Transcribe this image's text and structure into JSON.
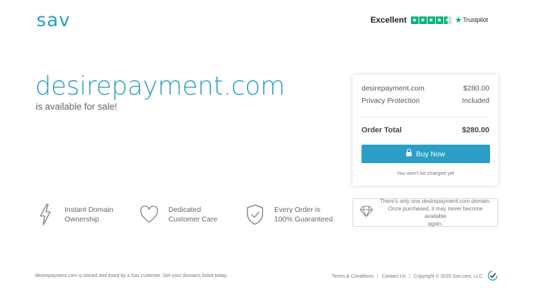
{
  "header": {
    "logo": "sav",
    "trustpilot": {
      "rating_label": "Excellent",
      "brand": "Trustpilot",
      "stars": 4.5
    }
  },
  "hero": {
    "domain": "desirepayment.com",
    "subtitle": "is available for sale!"
  },
  "order": {
    "items": [
      {
        "label": "desirepayment.com",
        "value": "$280.00"
      },
      {
        "label": "Privacy Protection",
        "value": "Included"
      }
    ],
    "total_label": "Order Total",
    "total_value": "$280.00",
    "buy_label": "Buy Now",
    "note": "You won't be charged yet"
  },
  "features": [
    {
      "line1": "Instant Domain",
      "line2": "Ownership",
      "icon": "lightning-icon"
    },
    {
      "line1": "Dedicated",
      "line2": "Customer Care",
      "icon": "heart-icon"
    },
    {
      "line1": "Every Order is",
      "line2": "100% Guaranteed",
      "icon": "shield-check-icon"
    }
  ],
  "notice": {
    "icon": "diamond-icon",
    "line1": "There's only one desirepayment.com domain.",
    "line2": "Once purchased, it may never become available",
    "line3": "again."
  },
  "footer": {
    "left_text": "desirepayment.com is owned and listed by a Sav customer. Get your domains listed today.",
    "terms": "Terms & Conditions",
    "contact": "Contact Us",
    "copyright": "Copyright © 2020 Sav.com, LLC"
  },
  "colors": {
    "accent": "#2b9fc6",
    "trustpilot_green": "#00b67a"
  }
}
